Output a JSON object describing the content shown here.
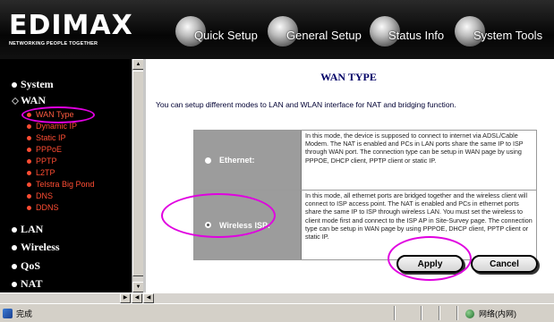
{
  "header": {
    "logo": "EDIMAX",
    "tagline": "NETWORKING PEOPLE TOGETHER",
    "nav": [
      "Quick Setup",
      "General Setup",
      "Status Info",
      "System Tools"
    ]
  },
  "sidebar": {
    "system": "System",
    "wan": "WAN",
    "wan_items": [
      "WAN Type",
      "Dynamic IP",
      "Static IP",
      "PPPoE",
      "PPTP",
      "L2TP",
      "Telstra Big Pond",
      "DNS",
      "DDNS"
    ],
    "lan": "LAN",
    "wireless": "Wireless",
    "qos": "QoS",
    "nat": "NAT"
  },
  "main": {
    "title": "WAN TYPE",
    "description": "You can setup different modes to LAN and WLAN interface for NAT and bridging function.",
    "options": [
      {
        "label": "Ethernet:",
        "checked": false,
        "text": "In this mode, the device is supposed to connect to internet via ADSL/Cable Modem. The NAT is enabled and PCs in LAN ports share the same IP to ISP through WAN port. The connection type can be setup in WAN page by using PPPOE, DHCP client, PPTP client or static IP."
      },
      {
        "label": "Wireless ISP:",
        "checked": true,
        "text": "In this mode, all ethernet ports are bridged together and the wireless client will connect to ISP access point. The NAT is enabled and PCs in ethernet ports share the same IP to ISP through wireless LAN. You must set the wireless to client mode first and connect to the ISP AP in Site-Survey page. The connection type can be setup in WAN page by using PPPOE, DHCP client, PPTP client or static IP."
      }
    ],
    "apply": "Apply",
    "cancel": "Cancel"
  },
  "statusbar": {
    "left": "完成",
    "right": "网络(内网)"
  },
  "colors": {
    "highlight_circle": "#e000e0",
    "submenu": "#ff4d33",
    "title": "#000066"
  }
}
